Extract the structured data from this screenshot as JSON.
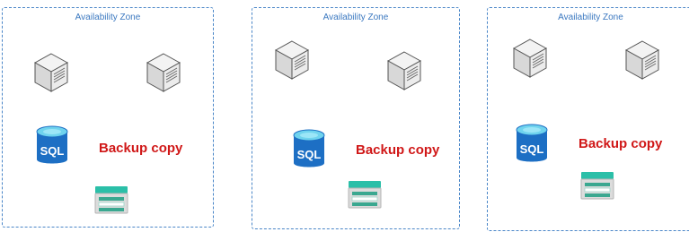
{
  "zones": [
    {
      "title": "Availability Zone",
      "backup_label": "Backup copy",
      "database_label": "SQL"
    },
    {
      "title": "Availability Zone",
      "backup_label": "Backup copy",
      "database_label": "SQL"
    },
    {
      "title": "Availability Zone",
      "backup_label": "Backup copy",
      "database_label": "SQL"
    }
  ],
  "colors": {
    "zone_border": "#4a86c8",
    "zone_title": "#3b78c0",
    "backup_label": "#d01818",
    "sql_blue": "#1d6fc4",
    "sql_top": "#6fd3ee",
    "storage_teal": "#2bbfa8"
  },
  "icons": {
    "server": "server-cube-icon",
    "database": "sql-database-icon",
    "storage": "storage-disk-icon"
  }
}
